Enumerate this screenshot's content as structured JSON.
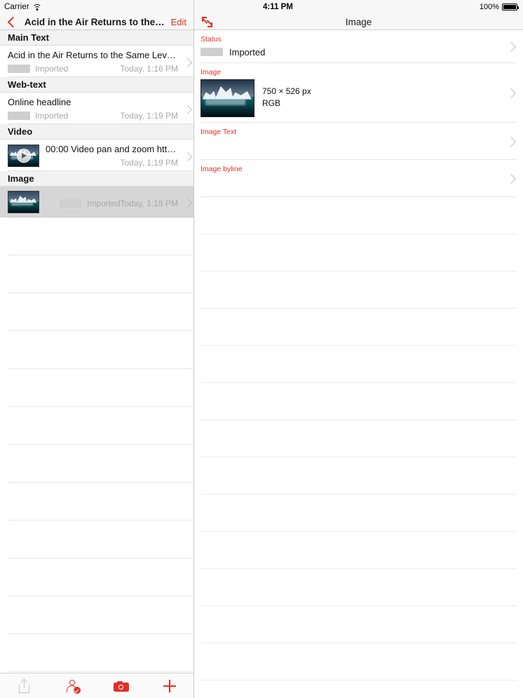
{
  "left": {
    "statusbar": {
      "carrier": "Carrier",
      "wifi_icon": "wifi-icon"
    },
    "navbar": {
      "back_icon": "chevron-left-icon",
      "title": "Acid in the Air Returns to the…",
      "edit_label": "Edit"
    },
    "sections": [
      {
        "header": "Main Text",
        "rows": [
          {
            "type": "text",
            "title": "Acid in the Air Returns to the Same Levels…",
            "status": "Imported",
            "time": "Today, 1:16 PM",
            "selected": false
          }
        ]
      },
      {
        "header": "Web-text",
        "rows": [
          {
            "type": "text",
            "title": "Online headline",
            "status": "Imported",
            "time": "Today, 1:19 PM",
            "selected": false
          }
        ]
      },
      {
        "header": "Video",
        "rows": [
          {
            "type": "video",
            "title": "00:00 Video pan and zoom https…",
            "status": "",
            "time": "Today, 1:19 PM",
            "selected": false
          }
        ]
      },
      {
        "header": "Image",
        "rows": [
          {
            "type": "image",
            "title": "",
            "status": "Imported",
            "time": "Today, 1:18 PM",
            "selected": true
          }
        ]
      }
    ],
    "empty_row_count": 12,
    "toolbar": {
      "buttons": [
        {
          "icon": "share-icon",
          "label": "Share",
          "enabled": false
        },
        {
          "icon": "person-check-icon",
          "label": "Assign",
          "enabled": true
        },
        {
          "icon": "camera-icon",
          "label": "Camera",
          "enabled": true
        },
        {
          "icon": "plus-icon",
          "label": "Add",
          "enabled": true
        }
      ]
    }
  },
  "right": {
    "statusbar": {
      "clock": "4:11 PM",
      "battery_percent": "100%"
    },
    "navbar": {
      "expand_icon": "expand-diagonal-icon",
      "title": "Image"
    },
    "fields": [
      {
        "label": "Status",
        "value": "Imported",
        "has_chip": true,
        "kind": "status"
      },
      {
        "label": "Image",
        "value": "",
        "kind": "image",
        "dimensions": "750 × 526 px",
        "color_space": "RGB"
      },
      {
        "label": "Image Text",
        "value": "",
        "kind": "empty"
      },
      {
        "label": "Image byline",
        "value": "",
        "kind": "empty"
      }
    ],
    "empty_row_count": 13
  },
  "colors": {
    "accent_red": "#e03127",
    "bar_background": "#f7f7f7",
    "section_header": "#f2f2f2",
    "selected_row": "#d6d6d6",
    "muted_text": "#a8a8a8",
    "separator": "#e6e6e6"
  }
}
